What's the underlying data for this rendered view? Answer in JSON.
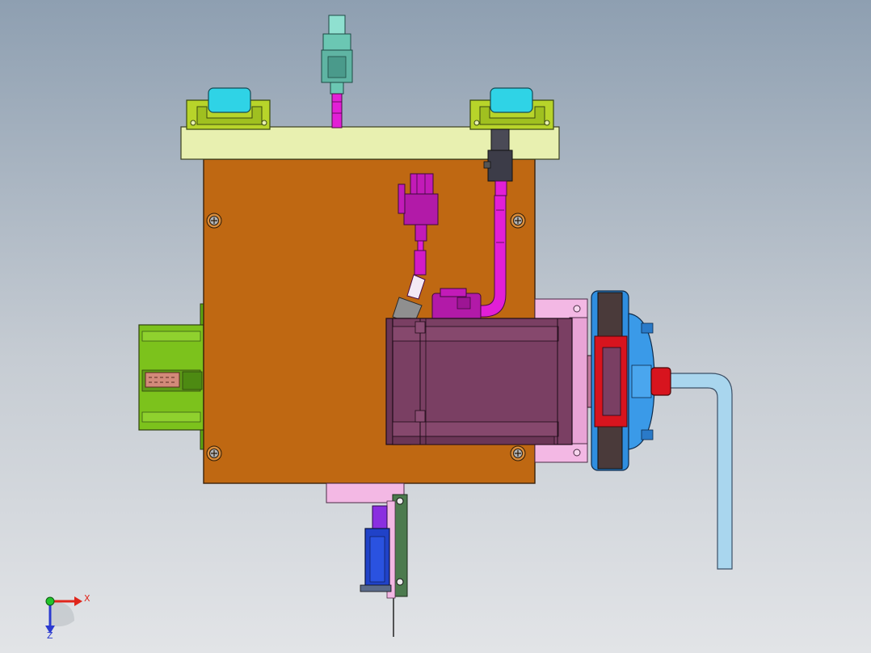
{
  "viewport": {
    "colors": {
      "background_top": "#8e9fb1",
      "background_bottom": "#e2e4e7",
      "mount_plate": "#bf6812",
      "top_bar": "#e8f0b0",
      "side_block": "#7cc21c",
      "motor_body": "#7a3f63",
      "cable_magenta": "#e21fd6",
      "pulley_blue": "#2f8ee0",
      "bracket_pink": "#f3b8e4",
      "rail_cyan": "#2fd3e6",
      "connector_teal": "#6bc7b3",
      "rod_light_blue": "#a9d6ee",
      "shaft_red": "#d7141e",
      "sensor_blue": "#2042c8"
    },
    "triad": {
      "x_label": "X",
      "z_label": "Z",
      "x_color": "#e0261c",
      "z_color": "#2b3ad0",
      "y_color": "#21c42b"
    }
  }
}
